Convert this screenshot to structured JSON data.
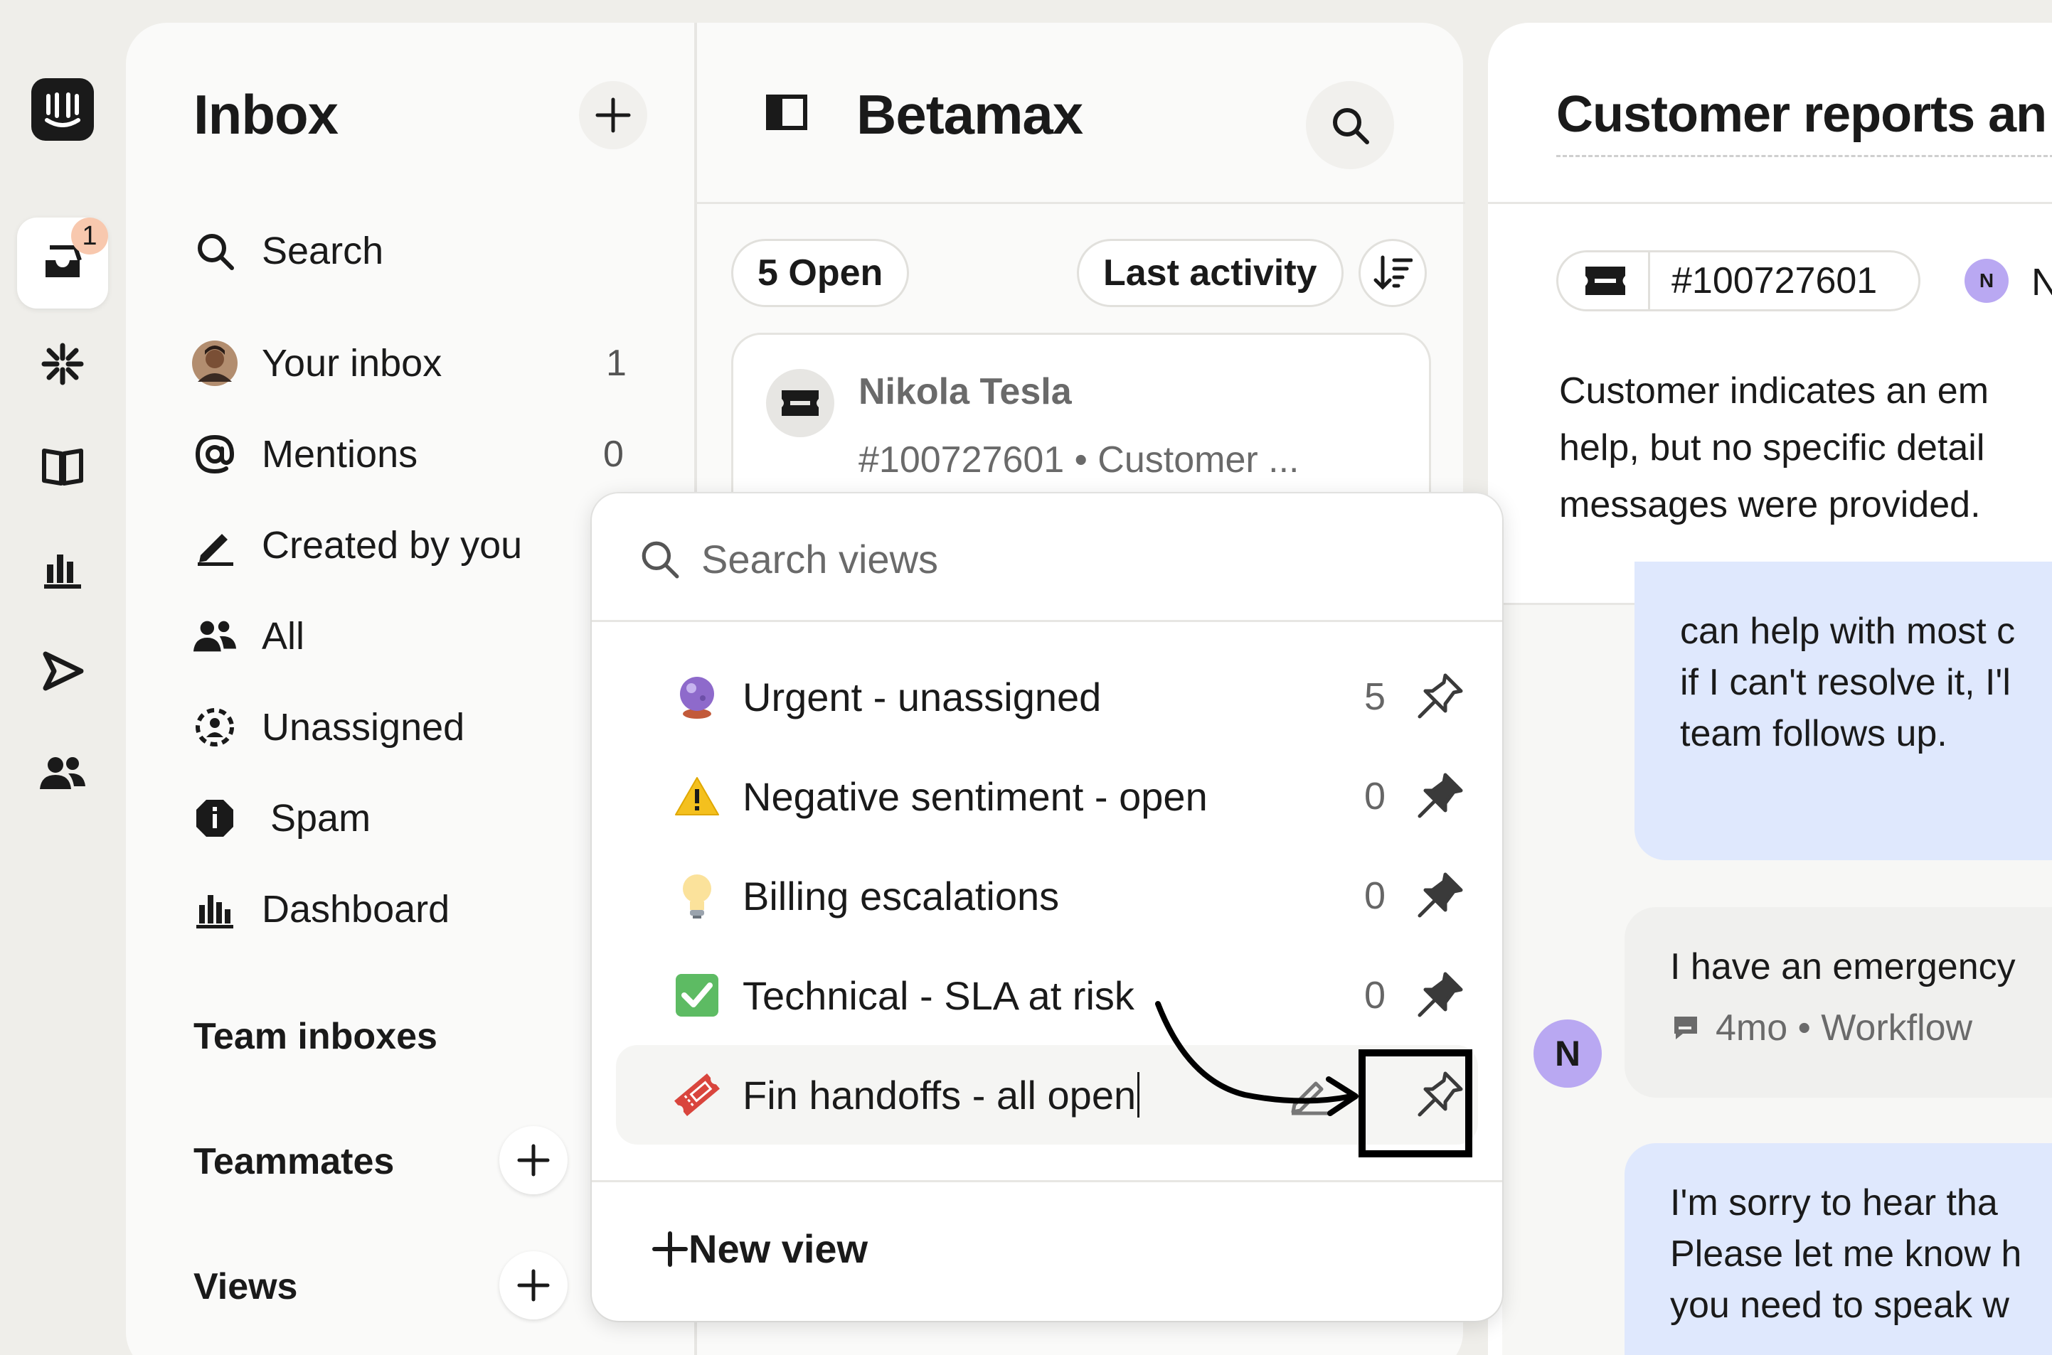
{
  "rail": {
    "inbox_badge": "1"
  },
  "inbox_panel": {
    "title": "Inbox",
    "nav": [
      {
        "label": "Search",
        "count": ""
      },
      {
        "label": "Your inbox",
        "count": "1"
      },
      {
        "label": "Mentions",
        "count": "0"
      },
      {
        "label": "Created by you",
        "count": ""
      },
      {
        "label": "All",
        "count": ""
      },
      {
        "label": "Unassigned",
        "count": ""
      },
      {
        "label": "Spam",
        "count": ""
      },
      {
        "label": "Dashboard",
        "count": ""
      }
    ],
    "sections": {
      "team_inboxes": "Team inboxes",
      "teammates": "Teammates",
      "views": "Views"
    }
  },
  "list_panel": {
    "title": "Betamax",
    "open_filter": "5 Open",
    "sort_label": "Last activity",
    "card": {
      "name": "Nikola Tesla",
      "subtitle": "#100727601 • Customer ..."
    }
  },
  "detail_panel": {
    "title": "Customer reports an e",
    "ticket_id": "#100727601",
    "avatar_letter": "N",
    "avatar_name_fragment": "N",
    "summary_lines": [
      "Customer indicates an em",
      "help, but no specific detail",
      "messages were provided."
    ],
    "bot_msg_lines": [
      "can help with most c",
      "if I can't resolve it, I'l",
      "team follows up."
    ],
    "user_msg": "I have an emergency",
    "user_msg_meta": "4mo • Workflow",
    "user_avatar_letter": "N",
    "reply_lines": [
      "I'm sorry to hear tha",
      "Please let me know h",
      "you need to speak w"
    ]
  },
  "views_popup": {
    "search_placeholder": "Search views",
    "views": [
      {
        "label": "Urgent - unassigned",
        "count": "5",
        "emoji": "crystal-ball-icon"
      },
      {
        "label": "Negative sentiment - open",
        "count": "0",
        "emoji": "warning-icon"
      },
      {
        "label": "Billing escalations",
        "count": "0",
        "emoji": "lightbulb-icon"
      },
      {
        "label": "Technical - SLA at risk",
        "count": "0",
        "emoji": "check-box-icon"
      },
      {
        "label": "Fin handoffs - all open",
        "count": "",
        "emoji": "ticket-icon"
      }
    ],
    "new_view_label": "New view"
  },
  "colors": {
    "badge": "#f8c8ae",
    "avatar_purple": "#b9a8f2",
    "bubble_blue": "#dfe8fd"
  }
}
